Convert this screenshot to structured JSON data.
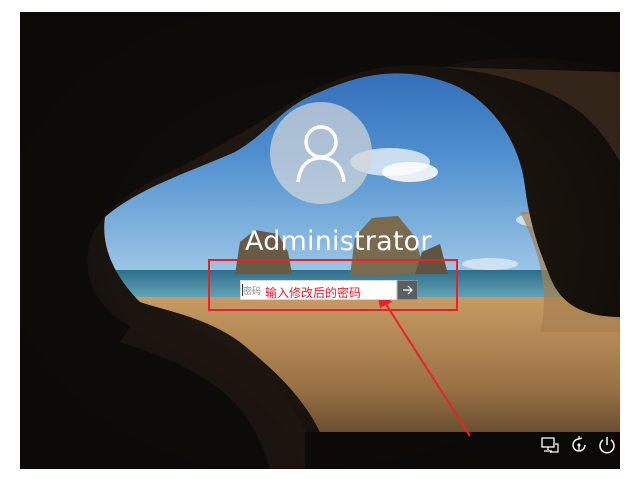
{
  "login": {
    "username": "Administrator",
    "password_placeholder": "密码",
    "annotation": "输入修改后的密码"
  },
  "icons": {
    "avatar": "user-silhouette-icon",
    "submit": "arrow-right-icon",
    "network": "network-icon",
    "ease_of_access": "ease-of-access-icon",
    "power": "power-icon"
  },
  "colors": {
    "annotation_red": "#e8212b",
    "sea": "#3f8aa8",
    "sky": "#2b63b5",
    "sand": "#b48a55"
  }
}
